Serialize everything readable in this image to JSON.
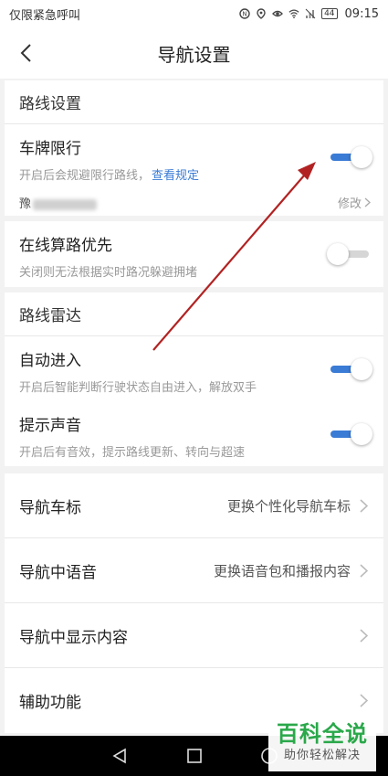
{
  "status_bar": {
    "carrier": "仅限紧急呼叫",
    "battery": "44",
    "time": "09:15"
  },
  "nav": {
    "title": "导航设置"
  },
  "route_settings": {
    "header": "路线设置",
    "plate_limit": {
      "label": "车牌限行",
      "desc": "开启后会规避限行路线，",
      "link": "查看规定",
      "enabled": true,
      "plate_prefix": "豫",
      "modify": "修改"
    }
  },
  "online_calc": {
    "label": "在线算路优先",
    "desc": "关闭则无法根据实时路况躲避拥堵",
    "enabled": false
  },
  "route_radar": {
    "header": "路线雷达",
    "auto_enter": {
      "label": "自动进入",
      "desc": "开启后智能判断行驶状态自由进入，解放双手",
      "enabled": true
    },
    "sound": {
      "label": "提示声音",
      "desc": "开启后有音效，提示路线更新、转向与超速",
      "enabled": true
    }
  },
  "nav_options": [
    {
      "label": "导航车标",
      "value": "更换个性化导航车标"
    },
    {
      "label": "导航中语音",
      "value": "更换语音包和播报内容"
    },
    {
      "label": "导航中显示内容",
      "value": ""
    },
    {
      "label": "辅助功能",
      "value": ""
    }
  ],
  "watermark": {
    "main": "百科全说",
    "sub": "助你轻松解决"
  },
  "colors": {
    "accent": "#3a7bd5",
    "annotation_arrow": "#b22222",
    "watermark_green": "#2aa84a"
  }
}
